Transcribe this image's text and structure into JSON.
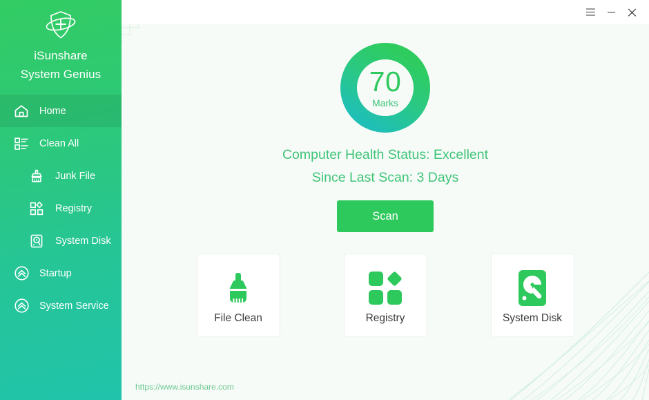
{
  "app": {
    "brand_line1": "iSunshare",
    "brand_line2": "System Genius",
    "logo_icon": "shield-orbit-icon"
  },
  "titlebar": {
    "menu_icon": "hamburger-menu-icon",
    "minimize_icon": "minimize-icon",
    "close_icon": "close-icon"
  },
  "sidebar": {
    "items": [
      {
        "label": "Home",
        "icon": "home-icon",
        "level": 1,
        "active": true
      },
      {
        "label": "Clean All",
        "icon": "clean-all-icon",
        "level": 1,
        "active": false
      },
      {
        "label": "Junk File",
        "icon": "brush-icon",
        "level": 2,
        "active": false
      },
      {
        "label": "Registry",
        "icon": "registry-icon",
        "level": 2,
        "active": false
      },
      {
        "label": "System Disk",
        "icon": "hard-disk-icon",
        "level": 2,
        "active": false
      },
      {
        "label": "Startup",
        "icon": "chevrons-up-icon",
        "level": 1,
        "active": false
      },
      {
        "label": "System Service",
        "icon": "chevrons-up-icon",
        "level": 1,
        "active": false
      }
    ]
  },
  "main": {
    "score": {
      "value": "70",
      "unit": "Marks",
      "percent": 100,
      "ring_color_start": "#2ecc5f",
      "ring_color_end": "#1fc0b4"
    },
    "health_status": "Computer Health Status: Excellent",
    "last_scan": "Since Last Scan: 3 Days",
    "scan_button": "Scan",
    "cards": [
      {
        "label": "File Clean",
        "icon": "broom-icon"
      },
      {
        "label": "Registry",
        "icon": "registry-blocks-icon"
      },
      {
        "label": "System Disk",
        "icon": "hard-drive-icon"
      }
    ],
    "footer_url": "https://www.isunshare.com"
  },
  "colors": {
    "sidebar_top": "#33cc63",
    "sidebar_bottom": "#21c4ab",
    "accent_green": "#2ec95c",
    "status_text": "#3fc478",
    "content_bg": "#f6fbf7"
  }
}
